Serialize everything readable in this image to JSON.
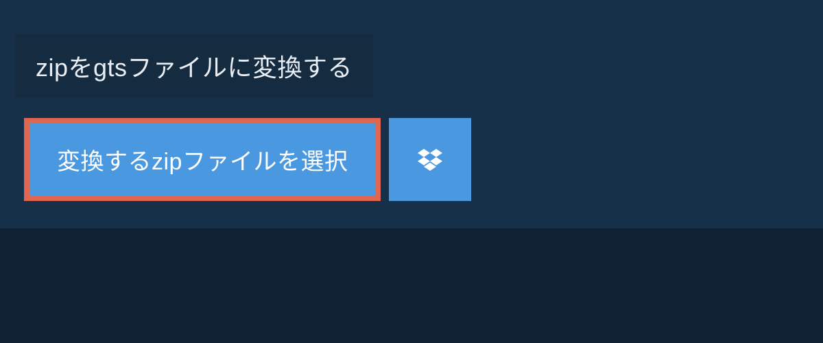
{
  "title": "zipをgtsファイルに変換する",
  "buttons": {
    "select_file_label": "変換するzipファイルを選択"
  },
  "colors": {
    "background": "#0f2133",
    "panel": "#163049",
    "title_bar": "#152b40",
    "button_primary": "#4a98e0",
    "button_border": "#e06652",
    "text_light": "#e8eef4",
    "text_white": "#ffffff"
  }
}
